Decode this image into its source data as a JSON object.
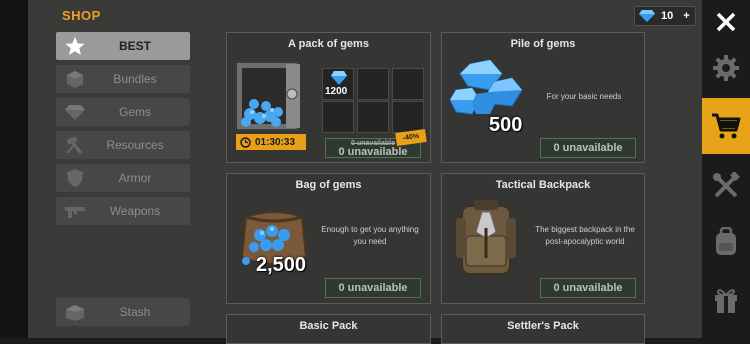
{
  "header": {
    "title": "SHOP",
    "gem_count": "10",
    "plus": "+"
  },
  "menu": {
    "items": [
      {
        "label": "BEST",
        "icon": "star-icon",
        "active": true
      },
      {
        "label": "Bundles",
        "icon": "cube-icon",
        "active": false
      },
      {
        "label": "Gems",
        "icon": "gem-icon",
        "active": false
      },
      {
        "label": "Resources",
        "icon": "hammer-icon",
        "active": false
      },
      {
        "label": "Armor",
        "icon": "shield-icon",
        "active": false
      },
      {
        "label": "Weapons",
        "icon": "gun-icon",
        "active": false
      }
    ],
    "stash_label": "Stash"
  },
  "cards": {
    "gem_pack": {
      "title": "A pack of gems",
      "slot_amount": "1200",
      "timer": "01:30:33",
      "discount": "-40%",
      "old_price": "0 unavailable",
      "button": "0 unavailable"
    },
    "pile": {
      "title": "Pile of gems",
      "desc": "For your basic needs",
      "amount": "500",
      "button": "0 unavailable"
    },
    "bag": {
      "title": "Bag of gems",
      "desc_line1": "Enough to get you anything",
      "desc_line2": "you need",
      "amount": "2,500",
      "button": "0 unavailable"
    },
    "backpack": {
      "title": "Tactical Backpack",
      "desc_line1": "The biggest backpack in the",
      "desc_line2": "post-apocalyptic world",
      "button": "0 unavailable"
    },
    "basic_pack": {
      "title": "Basic Pack"
    },
    "settlers_pack": {
      "title": "Settler's Pack"
    }
  },
  "nav": {
    "items": [
      "close-icon",
      "gear-icon",
      "cart-icon",
      "tools-icon",
      "backpack-icon",
      "gift-icon"
    ],
    "active": "cart-icon",
    "accent": "#e8a418"
  },
  "colors": {
    "accent": "#f0a020",
    "panel": "#3a3b38",
    "button_green": "#2e3a30"
  }
}
